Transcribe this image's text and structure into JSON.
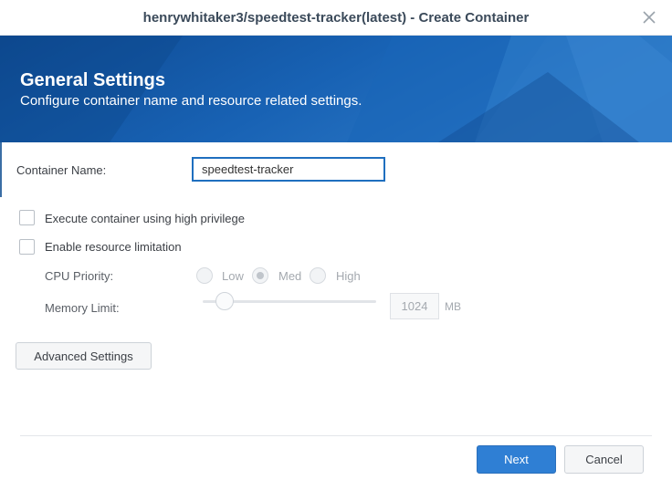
{
  "window": {
    "title": "henrywhitaker3/speedtest-tracker(latest) - Create Container"
  },
  "header": {
    "title": "General Settings",
    "subtitle": "Configure container name and resource related settings."
  },
  "form": {
    "container_name_label": "Container Name:",
    "container_name_value": "speedtest-tracker",
    "high_privilege_label": "Execute container using high privilege",
    "high_privilege_checked": false,
    "resource_limit_label": "Enable resource limitation",
    "resource_limit_checked": false,
    "cpu_priority_label": "CPU Priority:",
    "cpu_priority_options": [
      "Low",
      "Med",
      "High"
    ],
    "cpu_priority_selected": "Med",
    "memory_limit_label": "Memory Limit:",
    "memory_limit_value": "1024",
    "memory_limit_unit": "MB"
  },
  "buttons": {
    "advanced_settings": "Advanced Settings",
    "next": "Next",
    "cancel": "Cancel"
  },
  "colors": {
    "banner_dark": "#0f4f98",
    "banner_light": "#2d74c2",
    "primary": "#2f7fd4"
  },
  "icons": {
    "close": "close-icon"
  }
}
